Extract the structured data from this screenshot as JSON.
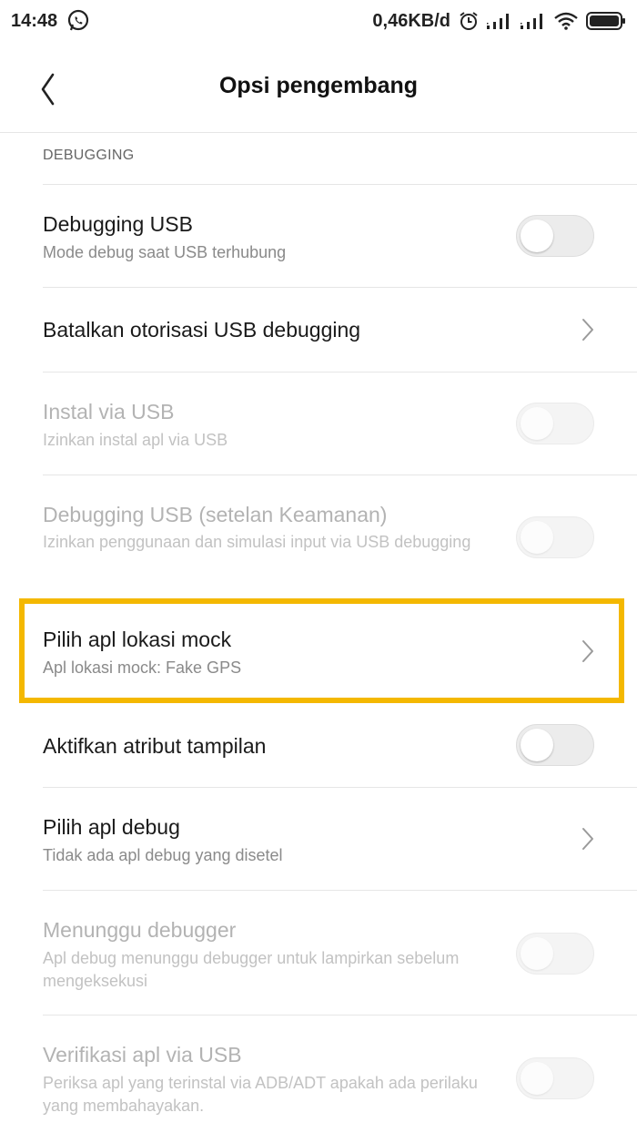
{
  "status_bar": {
    "time": "14:48",
    "speed": "0,46KB/d",
    "icons": [
      "whatsapp-icon",
      "alarm-icon",
      "signal-icon",
      "signal-icon",
      "wifi-icon",
      "battery-icon"
    ]
  },
  "header": {
    "title": "Opsi pengembang",
    "back_icon": "chevron-left-icon"
  },
  "section": {
    "label": "DEBUGGING"
  },
  "items": [
    {
      "title": "Debugging USB",
      "subtitle": "Mode debug saat USB terhubung",
      "control": "toggle",
      "enabled": true,
      "on": false
    },
    {
      "title": "Batalkan otorisasi USB debugging",
      "control": "chevron",
      "enabled": true
    },
    {
      "title": "Instal via USB",
      "subtitle": "Izinkan instal apl via USB",
      "control": "toggle",
      "enabled": false,
      "on": false
    },
    {
      "title": "Debugging USB (setelan Keamanan)",
      "subtitle": "Izinkan penggunaan dan simulasi input via USB debugging",
      "control": "toggle",
      "enabled": false,
      "on": false
    },
    {
      "title": "Pilih apl lokasi mock",
      "subtitle": "Apl lokasi mock: Fake GPS",
      "control": "chevron",
      "enabled": true,
      "highlighted": true
    },
    {
      "title": "Aktifkan atribut tampilan",
      "control": "toggle",
      "enabled": true,
      "on": false
    },
    {
      "title": "Pilih apl debug",
      "subtitle": "Tidak ada apl debug yang disetel",
      "control": "chevron",
      "enabled": true
    },
    {
      "title": "Menunggu debugger",
      "subtitle": "Apl debug menunggu debugger untuk lampirkan sebelum mengeksekusi",
      "control": "toggle",
      "enabled": false,
      "on": false
    },
    {
      "title": "Verifikasi apl via USB",
      "subtitle": "Periksa apl yang terinstal via ADB/ADT apakah ada perilaku yang membahayakan.",
      "control": "toggle",
      "enabled": false,
      "on": false
    }
  ],
  "colors": {
    "highlight": "#f4b800",
    "disabled_text": "#b3b3b3",
    "divider": "#e6e6e6"
  }
}
